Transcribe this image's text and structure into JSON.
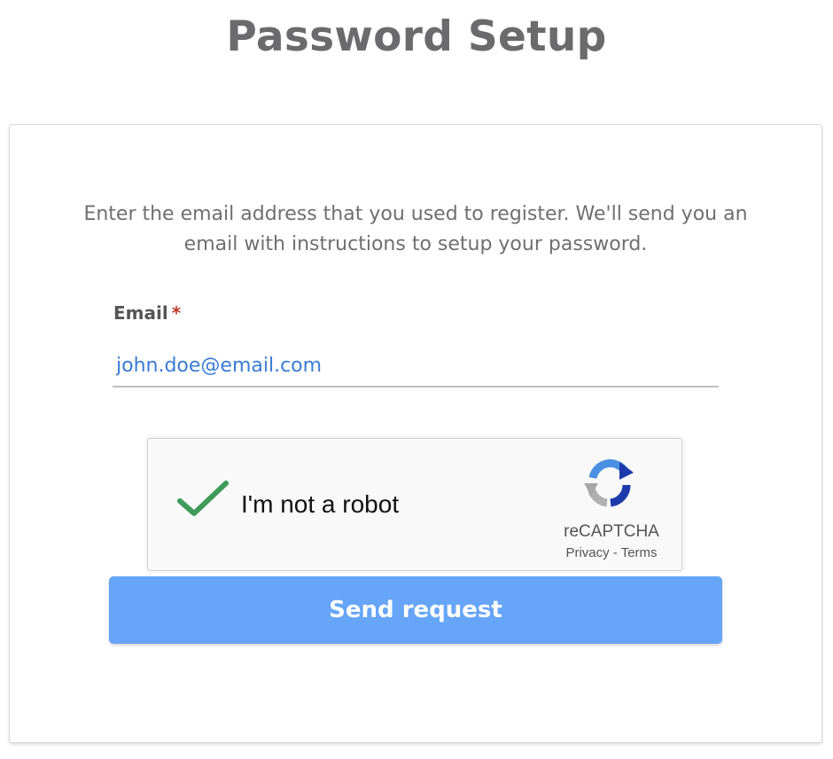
{
  "page": {
    "title": "Password Setup"
  },
  "form": {
    "intro_text": "Enter the email address that you used to register. We'll send you an email with instructions to setup your password.",
    "email_label": "Email",
    "required_marker": "*",
    "email_value": "john.doe@email.com",
    "submit_label": "Send request"
  },
  "recaptcha": {
    "checkbox_label": "I'm not a robot",
    "checked": true,
    "brand": "reCAPTCHA",
    "privacy_link": "Privacy",
    "separator": " - ",
    "terms_link": "Terms",
    "icons": {
      "check": "checkmark-icon",
      "logo": "recaptcha-logo-icon"
    }
  },
  "colors": {
    "title": "#6b6b6e",
    "text": "#6f6f6f",
    "input_text": "#3a7bd5",
    "required": "#c0392b",
    "button_bg": "#66a5f7",
    "button_text": "#ffffff",
    "check": "#3e9b5a"
  }
}
